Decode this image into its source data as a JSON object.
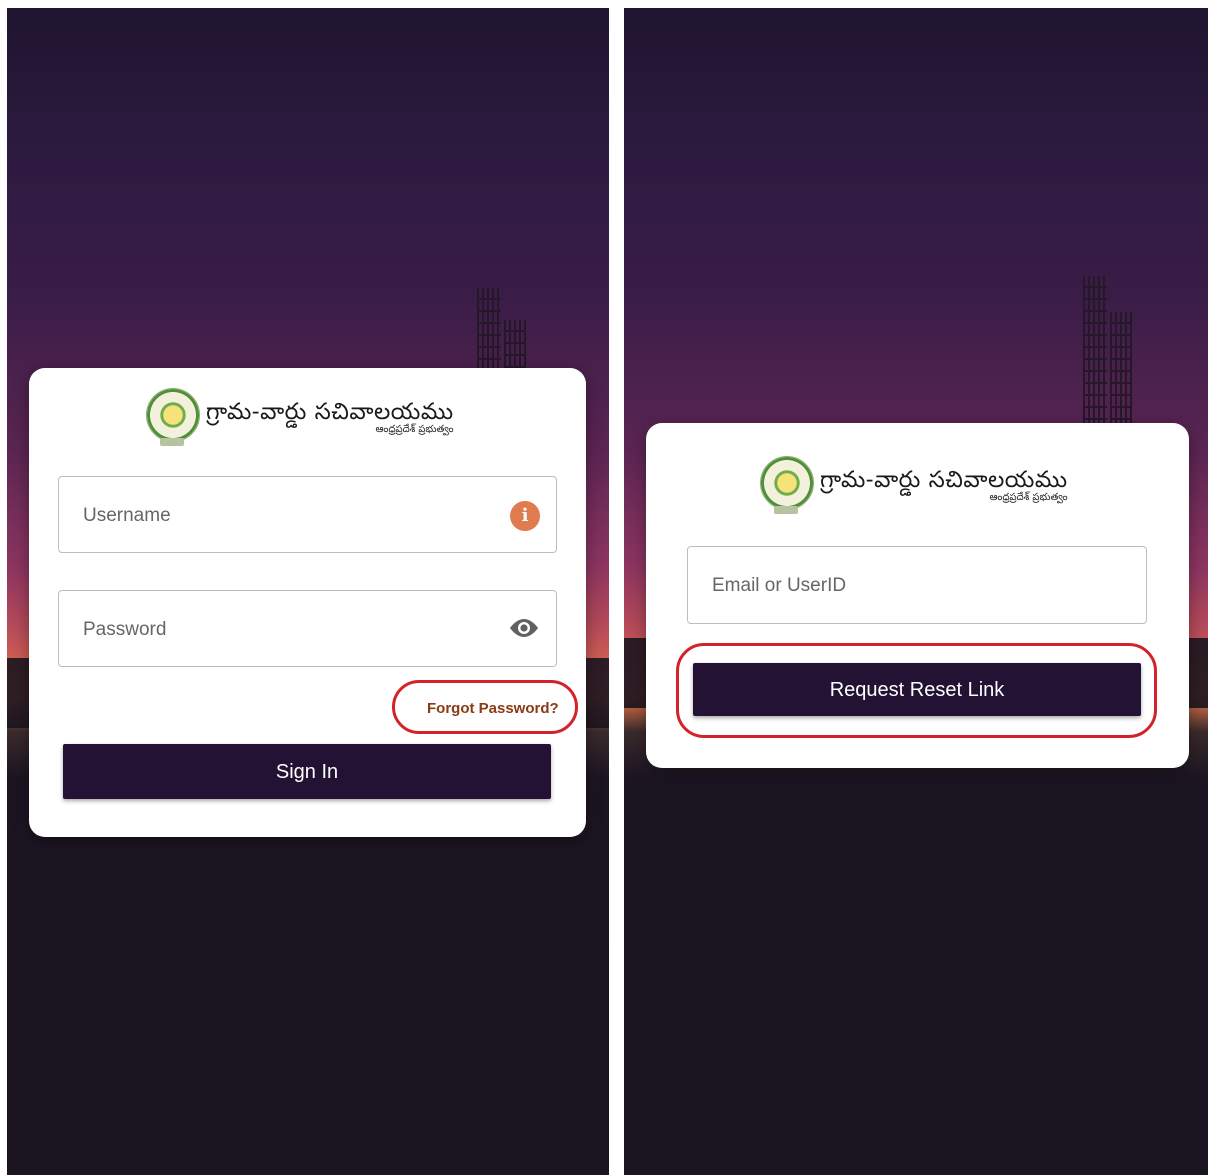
{
  "colors": {
    "primary_button": "#231233",
    "highlight": "#d2232a",
    "forgot_link": "#8a3b15",
    "info_icon": "#e07a4f"
  },
  "brand": {
    "title": "గ్రామ-వార్డు సచివాలయము",
    "subtitle": "ఆంధ్రప్రదేశ్ ప్రభుత్వం"
  },
  "login": {
    "username_placeholder": "Username",
    "password_placeholder": "Password",
    "username_icon": "info-icon",
    "password_icon": "eye-icon",
    "forgot_label": "Forgot Password?",
    "signin_label": "Sign In"
  },
  "reset": {
    "email_placeholder": "Email or UserID",
    "request_label": "Request Reset Link"
  }
}
